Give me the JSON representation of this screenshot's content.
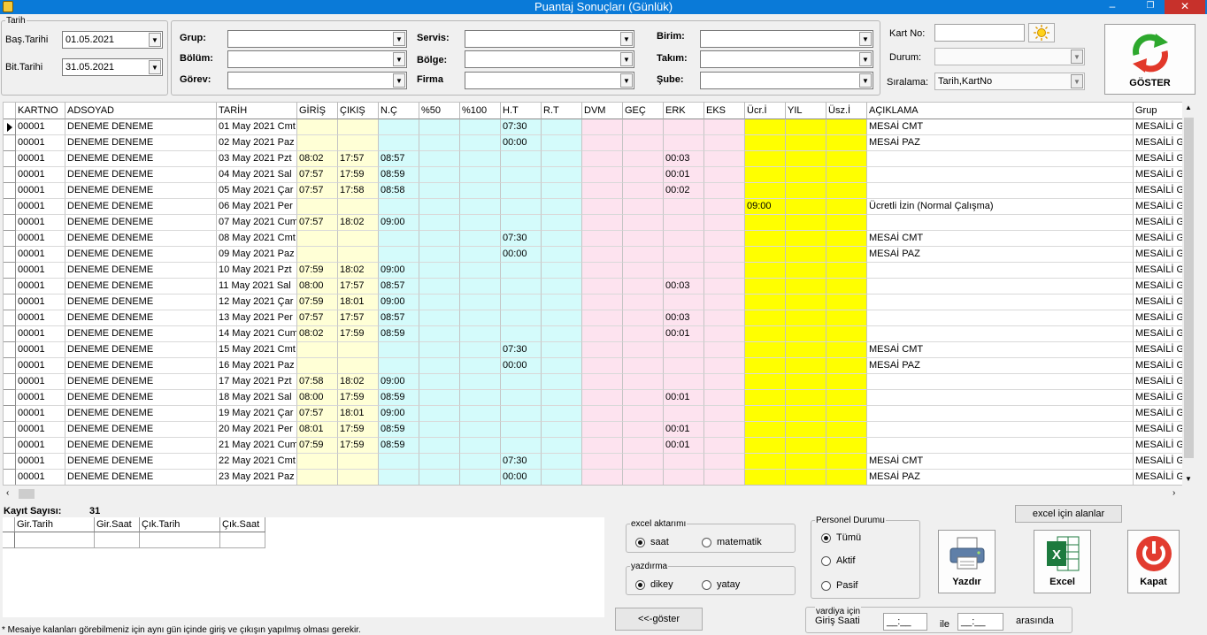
{
  "window": {
    "title": "Puantaj Sonuçları (Günlük)",
    "minimize": "–",
    "maximize": "❐",
    "close": "✕"
  },
  "filters": {
    "date_group": "Tarih",
    "start_label": "Baş.Tarihi",
    "start_value": "01.05.2021",
    "end_label": "Bit.Tarihi",
    "end_value": "31.05.2021",
    "grup": "Grup:",
    "bolum": "Bölüm:",
    "gorev": "Görev:",
    "servis": "Servis:",
    "bolge": "Bölge:",
    "firma": "Firma",
    "birim": "Birim:",
    "takim": "Takım:",
    "sube": "Şube:",
    "kartno": "Kart No:",
    "durum": "Durum:",
    "siralama": "Sıralama:",
    "siralama_value": "Tarih,KartNo",
    "goster": "GÖSTER"
  },
  "grid": {
    "columns": [
      "KARTNO",
      "ADSOYAD",
      "TARİH",
      "GİRİŞ",
      "ÇIKIŞ",
      "N.Ç",
      "%50",
      "%100",
      "H.T",
      "R.T",
      "DVM",
      "GEÇ",
      "ERK",
      "EKS",
      "Ücr.İ",
      "YIL",
      "Üsz.İ",
      "AÇIKLAMA",
      "Grup"
    ],
    "rows": [
      [
        "00001",
        "DENEME DENEME",
        "01 May 2021 Cmt",
        "",
        "",
        "",
        "",
        "",
        "07:30",
        "",
        "",
        "",
        "",
        "",
        "",
        "",
        "",
        "MESAİ CMT",
        "MESAİLİ G"
      ],
      [
        "00001",
        "DENEME DENEME",
        "02 May 2021 Paz",
        "",
        "",
        "",
        "",
        "",
        "00:00",
        "",
        "",
        "",
        "",
        "",
        "",
        "",
        "",
        "MESAİ PAZ",
        "MESAİLİ G"
      ],
      [
        "00001",
        "DENEME DENEME",
        "03 May 2021 Pzt",
        "08:02",
        "17:57",
        "08:57",
        "",
        "",
        "",
        "",
        "",
        "",
        "00:03",
        "",
        "",
        "",
        "",
        "",
        "MESAİLİ G"
      ],
      [
        "00001",
        "DENEME DENEME",
        "04 May 2021 Sal",
        "07:57",
        "17:59",
        "08:59",
        "",
        "",
        "",
        "",
        "",
        "",
        "00:01",
        "",
        "",
        "",
        "",
        "",
        "MESAİLİ G"
      ],
      [
        "00001",
        "DENEME DENEME",
        "05 May 2021 Çar",
        "07:57",
        "17:58",
        "08:58",
        "",
        "",
        "",
        "",
        "",
        "",
        "00:02",
        "",
        "",
        "",
        "",
        "",
        "MESAİLİ G"
      ],
      [
        "00001",
        "DENEME DENEME",
        "06 May 2021 Per",
        "",
        "",
        "",
        "",
        "",
        "",
        "",
        "",
        "",
        "",
        "",
        "09:00",
        "",
        "",
        "Ücretli İzin (Normal Çalışma)",
        "MESAİLİ G"
      ],
      [
        "00001",
        "DENEME DENEME",
        "07 May 2021 Cum",
        "07:57",
        "18:02",
        "09:00",
        "",
        "",
        "",
        "",
        "",
        "",
        "",
        "",
        "",
        "",
        "",
        "",
        "MESAİLİ G"
      ],
      [
        "00001",
        "DENEME DENEME",
        "08 May 2021 Cmt",
        "",
        "",
        "",
        "",
        "",
        "07:30",
        "",
        "",
        "",
        "",
        "",
        "",
        "",
        "",
        "MESAİ CMT",
        "MESAİLİ G"
      ],
      [
        "00001",
        "DENEME DENEME",
        "09 May 2021 Paz",
        "",
        "",
        "",
        "",
        "",
        "00:00",
        "",
        "",
        "",
        "",
        "",
        "",
        "",
        "",
        "MESAİ PAZ",
        "MESAİLİ G"
      ],
      [
        "00001",
        "DENEME DENEME",
        "10 May 2021 Pzt",
        "07:59",
        "18:02",
        "09:00",
        "",
        "",
        "",
        "",
        "",
        "",
        "",
        "",
        "",
        "",
        "",
        "",
        "MESAİLİ G"
      ],
      [
        "00001",
        "DENEME DENEME",
        "11 May 2021 Sal",
        "08:00",
        "17:57",
        "08:57",
        "",
        "",
        "",
        "",
        "",
        "",
        "00:03",
        "",
        "",
        "",
        "",
        "",
        "MESAİLİ G"
      ],
      [
        "00001",
        "DENEME DENEME",
        "12 May 2021 Çar",
        "07:59",
        "18:01",
        "09:00",
        "",
        "",
        "",
        "",
        "",
        "",
        "",
        "",
        "",
        "",
        "",
        "",
        "MESAİLİ G"
      ],
      [
        "00001",
        "DENEME DENEME",
        "13 May 2021 Per",
        "07:57",
        "17:57",
        "08:57",
        "",
        "",
        "",
        "",
        "",
        "",
        "00:03",
        "",
        "",
        "",
        "",
        "",
        "MESAİLİ G"
      ],
      [
        "00001",
        "DENEME DENEME",
        "14 May 2021 Cum",
        "08:02",
        "17:59",
        "08:59",
        "",
        "",
        "",
        "",
        "",
        "",
        "00:01",
        "",
        "",
        "",
        "",
        "",
        "MESAİLİ G"
      ],
      [
        "00001",
        "DENEME DENEME",
        "15 May 2021 Cmt",
        "",
        "",
        "",
        "",
        "",
        "07:30",
        "",
        "",
        "",
        "",
        "",
        "",
        "",
        "",
        "MESAİ CMT",
        "MESAİLİ G"
      ],
      [
        "00001",
        "DENEME DENEME",
        "16 May 2021 Paz",
        "",
        "",
        "",
        "",
        "",
        "00:00",
        "",
        "",
        "",
        "",
        "",
        "",
        "",
        "",
        "MESAİ PAZ",
        "MESAİLİ G"
      ],
      [
        "00001",
        "DENEME DENEME",
        "17 May 2021 Pzt",
        "07:58",
        "18:02",
        "09:00",
        "",
        "",
        "",
        "",
        "",
        "",
        "",
        "",
        "",
        "",
        "",
        "",
        "MESAİLİ G"
      ],
      [
        "00001",
        "DENEME DENEME",
        "18 May 2021 Sal",
        "08:00",
        "17:59",
        "08:59",
        "",
        "",
        "",
        "",
        "",
        "",
        "00:01",
        "",
        "",
        "",
        "",
        "",
        "MESAİLİ G"
      ],
      [
        "00001",
        "DENEME DENEME",
        "19 May 2021 Çar",
        "07:57",
        "18:01",
        "09:00",
        "",
        "",
        "",
        "",
        "",
        "",
        "",
        "",
        "",
        "",
        "",
        "",
        "MESAİLİ G"
      ],
      [
        "00001",
        "DENEME DENEME",
        "20 May 2021 Per",
        "08:01",
        "17:59",
        "08:59",
        "",
        "",
        "",
        "",
        "",
        "",
        "00:01",
        "",
        "",
        "",
        "",
        "",
        "MESAİLİ G"
      ],
      [
        "00001",
        "DENEME DENEME",
        "21 May 2021 Cum",
        "07:59",
        "17:59",
        "08:59",
        "",
        "",
        "",
        "",
        "",
        "",
        "00:01",
        "",
        "",
        "",
        "",
        "",
        "MESAİLİ G"
      ],
      [
        "00001",
        "DENEME DENEME",
        "22 May 2021 Cmt",
        "",
        "",
        "",
        "",
        "",
        "07:30",
        "",
        "",
        "",
        "",
        "",
        "",
        "",
        "",
        "MESAİ CMT",
        "MESAİLİ G"
      ],
      [
        "00001",
        "DENEME DENEME",
        "23 May 2021 Paz",
        "",
        "",
        "",
        "",
        "",
        "00:00",
        "",
        "",
        "",
        "",
        "",
        "",
        "",
        "",
        "MESAİ PAZ",
        "MESAİLİ G"
      ]
    ]
  },
  "bottom": {
    "kayit_label": "Kayıt Sayısı:",
    "kayit_value": "31",
    "sub_columns": [
      "Gir.Tarih",
      "Gir.Saat",
      "Çık.Tarih",
      "Çık.Saat"
    ],
    "excel_alanlar": "excel için alanlar",
    "excel_aktarimi": "excel aktarımı",
    "saat": "saat",
    "matematik": "matematik",
    "yazdirma": "yazdırma",
    "dikey": "dikey",
    "yatay": "yatay",
    "personel_durumu": "Personel Durumu",
    "tumu": "Tümü",
    "aktif": "Aktif",
    "pasif": "Pasif",
    "yazdir": "Yazdır",
    "excel": "Excel",
    "kapat": "Kapat",
    "geri_goster": "<<-göster",
    "vardiya": "vardiya için",
    "giris_saati": "Giriş Saati",
    "time_from": "__:__",
    "ile": "ile",
    "time_to": "__:__",
    "arasinda": "arasında",
    "note": "* Mesaiye kalanları görebilmeniz için aynı gün içinde giriş ve çıkışın yapılmış olması gerekir."
  },
  "colors": {
    "yellow_light": "#ffffd6",
    "cyan_light": "#d4fbfb",
    "pink_light": "#fde3ef",
    "yellow": "#ffff00",
    "title_blue": "#0a7ad8"
  }
}
